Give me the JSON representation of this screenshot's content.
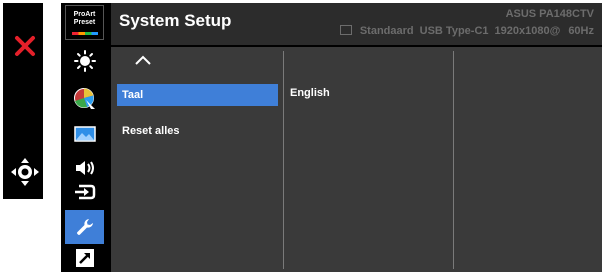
{
  "keys": {
    "close_icon": "close-x-icon",
    "nav_icon": "five-way-navigation-icon"
  },
  "logo": {
    "line1": "ProArt",
    "line2": "Preset"
  },
  "header": {
    "title": "System Setup",
    "model": "ASUS PA148CTV",
    "preset": "Standaard",
    "input": "USB Type-C1",
    "resolution": "1920x1080@",
    "refresh": "60Hz"
  },
  "sidebar": {
    "items": [
      {
        "name": "brightness-icon",
        "active": false
      },
      {
        "name": "color-icon",
        "active": false
      },
      {
        "name": "image-icon",
        "active": false
      },
      {
        "name": "sound-icon",
        "active": false
      },
      {
        "name": "input-select-icon",
        "active": false
      },
      {
        "name": "wrench-icon",
        "active": true
      },
      {
        "name": "shortcut-icon",
        "active": false
      }
    ]
  },
  "menu": {
    "items": [
      {
        "label": "Taal",
        "active": true
      },
      {
        "label": "Reset alles",
        "active": false
      }
    ],
    "selected_value": "English"
  },
  "colors": {
    "accent": "#3f7fd8",
    "close": "#e4202a",
    "header": "#2c2c2c",
    "panel": "#3a3a3a"
  }
}
